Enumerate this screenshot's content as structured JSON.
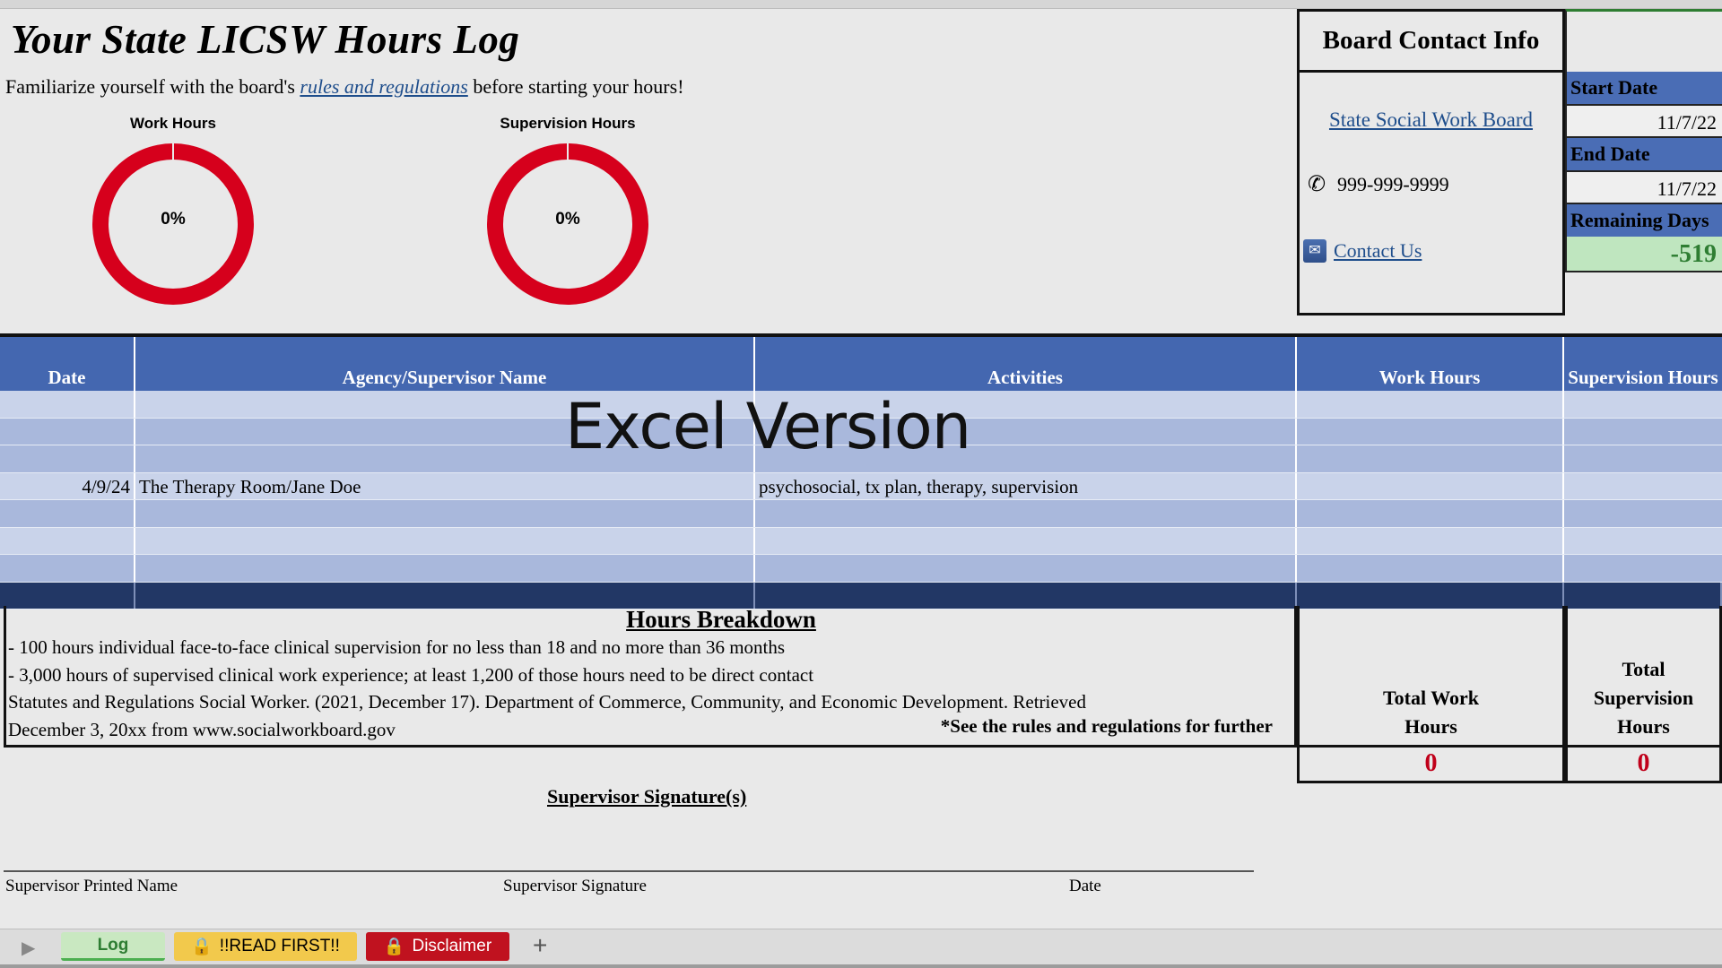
{
  "title": "Your State LICSW Hours Log",
  "subtitle": {
    "before": "Familiarize yourself with the board's ",
    "link": "rules and regulations",
    "after": " before starting your hours!"
  },
  "charts": {
    "work": {
      "title": "Work Hours",
      "value_label": "0%",
      "percent": 0
    },
    "supervision": {
      "title": "Supervision Hours",
      "value_label": "0%",
      "percent": 0
    }
  },
  "chart_data": [
    {
      "type": "pie",
      "title": "Work Hours",
      "values": [
        0
      ],
      "label": "0%"
    },
    {
      "type": "pie",
      "title": "Supervision Hours",
      "values": [
        0
      ],
      "label": "0%"
    }
  ],
  "board": {
    "heading": "Board Contact Info",
    "board_link": "State Social Work Board",
    "phone": "999-999-9999",
    "contact_link": "Contact Us"
  },
  "dates": {
    "start_label": "Start Date",
    "start_value": "11/7/22",
    "end_label": "End Date",
    "end_value": "11/7/22",
    "remaining_label": "Remaining Days",
    "remaining_value": "-519"
  },
  "table": {
    "headers": {
      "date": "Date",
      "agency": "Agency/Supervisor Name",
      "activities": "Activities",
      "work_hours": "Work Hours",
      "supervision_hours": "Supervision Hours"
    },
    "entry": {
      "date": "4/9/24",
      "agency": "The Therapy Room/Jane Doe",
      "activities": "psychosocial, tx plan, therapy, supervision"
    }
  },
  "overlay_text": "Excel Version",
  "breakdown": {
    "title": "Hours Breakdown",
    "line1": "- 100 hours individual face-to-face clinical supervision for no less than 18 and no more than 36 months",
    "line2": "- 3,000 hours of supervised clinical work experience; at least 1,200 of those hours need to be direct contact",
    "line3": "Statutes and Regulations Social Worker. (2021, December 17). Department of Commerce, Community, and Economic Development. Retrieved",
    "line4": "December 3, 20xx from www.socialworkboard.gov",
    "note": "*See the rules and regulations for further"
  },
  "totals": {
    "work_label": "Total Work Hours",
    "work_value": "0",
    "supervision_label": "Total Supervision Hours",
    "supervision_value": "0"
  },
  "signatures": {
    "title": "Supervisor Signature(s)",
    "printed_name": "Supervisor Printed Name",
    "signature": "Supervisor Signature",
    "date": "Date"
  },
  "tabs": {
    "log": "Log",
    "read_first": "!!READ FIRST!!",
    "disclaimer": "Disclaimer",
    "add": "+"
  },
  "colors": {
    "header_blue": "#4467b0",
    "donut_red": "#d6001c",
    "remaining_green": "#2e7d32",
    "total_red": "#c0001a"
  }
}
